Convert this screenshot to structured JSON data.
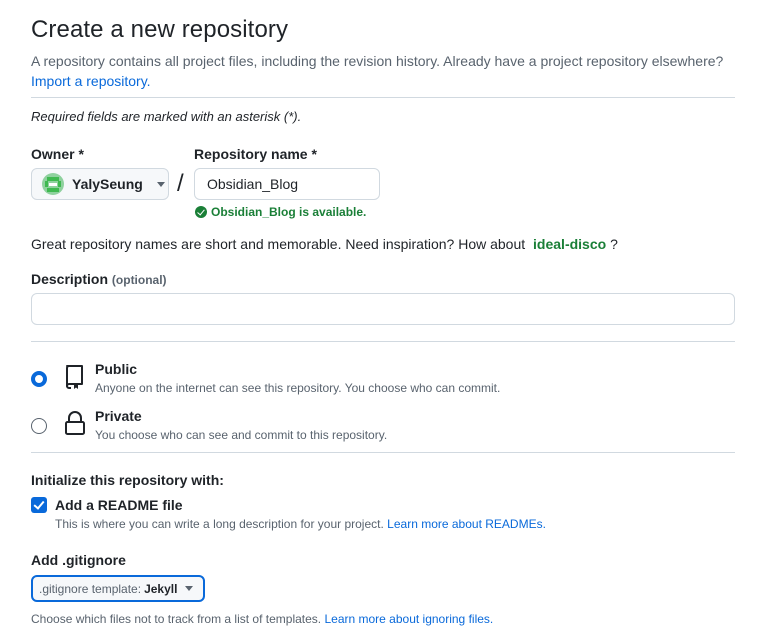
{
  "header": {
    "title": "Create a new repository",
    "intro": "A repository contains all project files, including the revision history. Already have a project repository elsewhere?",
    "import_link": "Import a repository."
  },
  "required_note": "Required fields are marked with an asterisk (*).",
  "owner": {
    "label": "Owner *",
    "value": "YalySeung",
    "icon": "avatar-icon"
  },
  "separator": "/",
  "repo_name": {
    "label": "Repository name *",
    "value": "Obsidian_Blog",
    "availability": "Obsidian_Blog is available.",
    "status_color": "#1a7f37"
  },
  "inspiration": {
    "text": "Great repository names are short and memorable. Need inspiration? How about",
    "suggestion": "ideal-disco",
    "suffix": "?"
  },
  "description": {
    "label": "Description",
    "optional": "(optional)",
    "value": ""
  },
  "visibility": {
    "selected": "public",
    "options": [
      {
        "id": "public",
        "title": "Public",
        "desc": "Anyone on the internet can see this repository. You choose who can commit.",
        "icon": "repo-icon"
      },
      {
        "id": "private",
        "title": "Private",
        "desc": "You choose who can see and commit to this repository.",
        "icon": "lock-icon"
      }
    ]
  },
  "initialize": {
    "label": "Initialize this repository with:",
    "readme": {
      "checked": true,
      "title": "Add a README file",
      "desc": "This is where you can write a long description for your project.",
      "link": "Learn more about READMEs."
    }
  },
  "gitignore": {
    "label": "Add .gitignore",
    "prefix": ".gitignore template:",
    "value": "Jekyll",
    "desc": "Choose which files not to track from a list of templates.",
    "link": "Learn more about ignoring files."
  },
  "colors": {
    "accent": "#0969da",
    "success": "#1a7f37",
    "muted": "#59636e",
    "border": "#d1d9e0"
  }
}
